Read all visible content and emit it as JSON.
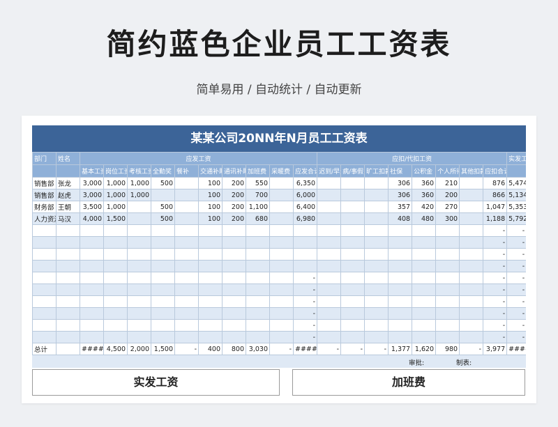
{
  "page": {
    "title": "简约蓝色企业员工工资表",
    "subtitle": "简单易用 / 自动统计 / 自动更新"
  },
  "sheet": {
    "title": "某某公司20NN年N月员工工资表",
    "group_headers": [
      "部门",
      "姓名",
      "应发工资",
      "应扣/代扣工资",
      "实发工资"
    ],
    "columns": [
      "",
      "",
      "基本工资",
      "岗位工资",
      "考核工资",
      "全勤奖",
      "餐补",
      "交通补助",
      "通讯补助",
      "加班费",
      "采暖费",
      "应发合计",
      "迟到/早退",
      "病/事假",
      "旷工扣款",
      "社保",
      "公积金",
      "个人所得税",
      "其他扣款",
      "应扣合计",
      ""
    ],
    "rows": [
      [
        "销售部",
        "张龙",
        "3,000",
        "1,000",
        "1,000",
        "500",
        "",
        "100",
        "200",
        "550",
        "",
        "6,350",
        "",
        "",
        "",
        "306",
        "360",
        "210",
        "",
        "876",
        "5,474"
      ],
      [
        "销售部",
        "赵虎",
        "3,000",
        "1,000",
        "1,000",
        "",
        "",
        "100",
        "200",
        "700",
        "",
        "6,000",
        "",
        "",
        "",
        "306",
        "360",
        "200",
        "",
        "866",
        "5,134"
      ],
      [
        "财务部",
        "王朝",
        "3,500",
        "1,000",
        "",
        "500",
        "",
        "100",
        "200",
        "1,100",
        "",
        "6,400",
        "",
        "",
        "",
        "357",
        "420",
        "270",
        "",
        "1,047",
        "5,353"
      ],
      [
        "人力资源",
        "马汉",
        "4,000",
        "1,500",
        "",
        "500",
        "",
        "100",
        "200",
        "680",
        "",
        "6,980",
        "",
        "",
        "",
        "408",
        "480",
        "300",
        "",
        "1,188",
        "5,792"
      ],
      [
        "",
        "",
        "",
        "",
        "",
        "",
        "",
        "",
        "",
        "",
        "",
        "",
        "",
        "",
        "",
        "",
        "",
        "",
        "",
        "-",
        "-"
      ],
      [
        "",
        "",
        "",
        "",
        "",
        "",
        "",
        "",
        "",
        "",
        "",
        "",
        "",
        "",
        "",
        "",
        "",
        "",
        "",
        "-",
        "-"
      ],
      [
        "",
        "",
        "",
        "",
        "",
        "",
        "",
        "",
        "",
        "",
        "",
        "",
        "",
        "",
        "",
        "",
        "",
        "",
        "",
        "-",
        "-"
      ],
      [
        "",
        "",
        "",
        "",
        "",
        "",
        "",
        "",
        "",
        "",
        "",
        "",
        "",
        "",
        "",
        "",
        "",
        "",
        "",
        "-",
        "-"
      ],
      [
        "",
        "",
        "",
        "",
        "",
        "",
        "",
        "",
        "",
        "",
        "",
        "-",
        "",
        "",
        "",
        "",
        "",
        "",
        "",
        "-",
        "-"
      ],
      [
        "",
        "",
        "",
        "",
        "",
        "",
        "",
        "",
        "",
        "",
        "",
        "-",
        "",
        "",
        "",
        "",
        "",
        "",
        "",
        "-",
        "-"
      ],
      [
        "",
        "",
        "",
        "",
        "",
        "",
        "",
        "",
        "",
        "",
        "",
        "-",
        "",
        "",
        "",
        "",
        "",
        "",
        "",
        "-",
        "-"
      ],
      [
        "",
        "",
        "",
        "",
        "",
        "",
        "",
        "",
        "",
        "",
        "",
        "-",
        "",
        "",
        "",
        "",
        "",
        "",
        "",
        "-",
        "-"
      ],
      [
        "",
        "",
        "",
        "",
        "",
        "",
        "",
        "",
        "",
        "",
        "",
        "-",
        "",
        "",
        "",
        "",
        "",
        "",
        "",
        "-",
        "-"
      ],
      [
        "",
        "",
        "",
        "",
        "",
        "",
        "",
        "",
        "",
        "",
        "",
        "-",
        "",
        "",
        "",
        "",
        "",
        "",
        "",
        "-",
        "-"
      ]
    ],
    "total": [
      "总计",
      "",
      "####",
      "4,500",
      "2,000",
      "1,500",
      "-",
      "400",
      "800",
      "3,030",
      "-",
      "####",
      "-",
      "-",
      "-",
      "1,377",
      "1,620",
      "980",
      "-",
      "3,977",
      "####"
    ],
    "footer": {
      "approve_label": "审批:",
      "prepare_label": "制表:"
    }
  },
  "buttons": {
    "net_pay": "实发工资",
    "overtime": "加班费"
  },
  "colors": {
    "header_dark": "#3c6498",
    "header_light": "#8fb0d8",
    "row_alt": "#dfe9f5"
  }
}
